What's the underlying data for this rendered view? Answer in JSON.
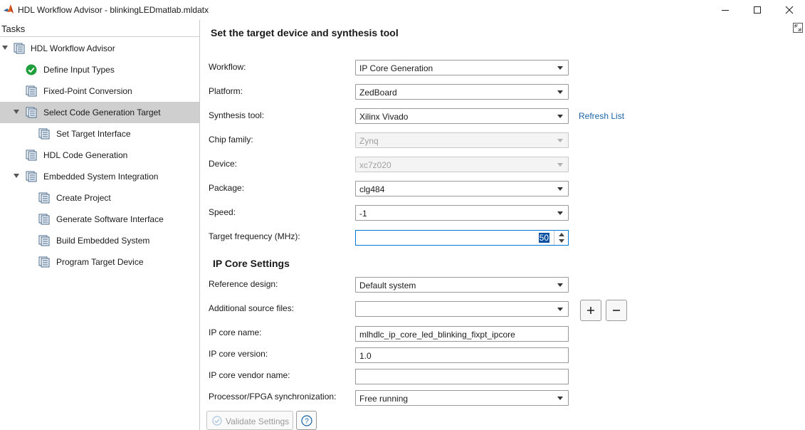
{
  "window": {
    "title": "HDL Workflow Advisor - blinkingLEDmatlab.mldatx",
    "minimize_glyph": "—",
    "maximize_glyph": "☐",
    "close_glyph": "✕"
  },
  "tasks": {
    "header": "Tasks",
    "items": [
      {
        "label": "HDL Workflow Advisor",
        "icon": "task-folder-icon",
        "level": 0,
        "expanded": true
      },
      {
        "label": "Define Input Types",
        "icon": "check-pass-icon",
        "level": 1
      },
      {
        "label": "Fixed-Point Conversion",
        "icon": "task-icon",
        "level": 1
      },
      {
        "label": "Select Code Generation Target",
        "icon": "task-folder-icon",
        "level": 1,
        "expanded": true,
        "selected": true
      },
      {
        "label": "Set Target Interface",
        "icon": "task-icon",
        "level": 2
      },
      {
        "label": "HDL Code Generation",
        "icon": "task-icon",
        "level": 1
      },
      {
        "label": "Embedded System Integration",
        "icon": "task-folder-icon",
        "level": 1,
        "expanded": true
      },
      {
        "label": "Create Project",
        "icon": "task-icon",
        "level": 2
      },
      {
        "label": "Generate Software Interface",
        "icon": "task-icon",
        "level": 2
      },
      {
        "label": "Build Embedded System",
        "icon": "task-icon",
        "level": 2
      },
      {
        "label": "Program Target Device",
        "icon": "task-icon",
        "level": 2
      }
    ]
  },
  "main": {
    "title": "Set the target device and synthesis tool",
    "fields": {
      "workflow": {
        "label": "Workflow:",
        "value": "IP Core Generation"
      },
      "platform": {
        "label": "Platform:",
        "value": "ZedBoard"
      },
      "synthesis_tool": {
        "label": "Synthesis tool:",
        "value": "Xilinx Vivado"
      },
      "chip_family": {
        "label": "Chip family:",
        "value": "Zynq"
      },
      "device": {
        "label": "Device:",
        "value": "xc7z020"
      },
      "package": {
        "label": "Package:",
        "value": "clg484"
      },
      "speed": {
        "label": "Speed:",
        "value": "-1"
      },
      "target_frequency": {
        "label": "Target frequency (MHz):",
        "value": "50"
      }
    },
    "refresh_list": "Refresh List",
    "ip_core_settings": {
      "title": "IP Core Settings",
      "reference_design": {
        "label": "Reference design:",
        "value": "Default system"
      },
      "additional_source_files": {
        "label": "Additional source files:",
        "value": ""
      },
      "add_glyph": "+",
      "remove_glyph": "−",
      "ip_core_name": {
        "label": "IP core name:",
        "value": "mlhdlc_ip_core_led_blinking_fixpt_ipcore"
      },
      "ip_core_version": {
        "label": "IP core version:",
        "value": "1.0"
      },
      "ip_core_vendor_name": {
        "label": "IP core vendor name:",
        "value": ""
      },
      "sync": {
        "label": "Processor/FPGA synchronization:",
        "value": "Free running"
      }
    },
    "validate_label": "Validate Settings",
    "help_glyph": "?"
  },
  "colors": {
    "accent": "#0078d4",
    "link": "#1a63a8",
    "selection": "#cfcfcf",
    "pass_green": "#1f9e3c"
  }
}
